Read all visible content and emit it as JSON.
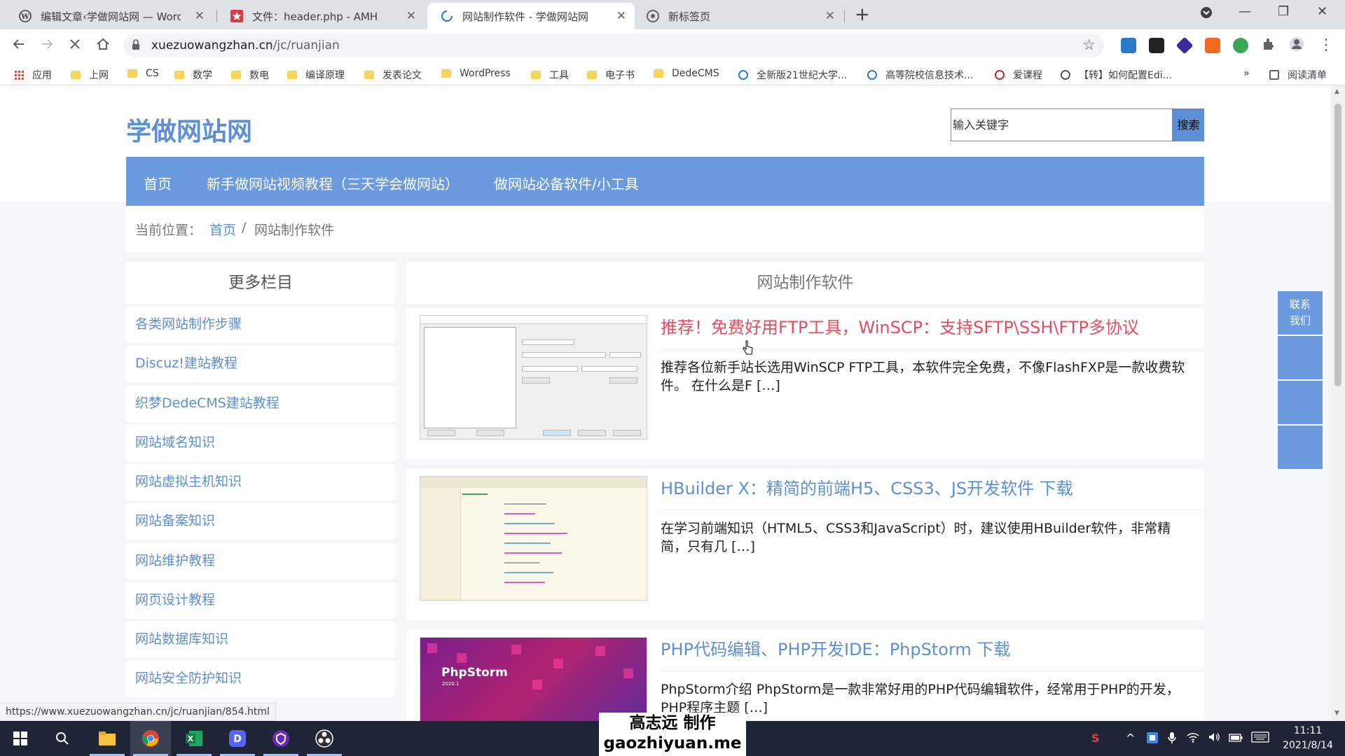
{
  "browser": {
    "tabs": [
      {
        "title": "编辑文章‹学做网站网 — Word",
        "close": "✕"
      },
      {
        "title": "文件：header.php - AMH",
        "close": "✕"
      },
      {
        "title": "网站制作软件 - 学做网站网",
        "close": "✕"
      },
      {
        "title": "新标签页",
        "close": "✕"
      }
    ],
    "new_tab": "+",
    "window_controls": {
      "minimize": "—",
      "restore": "❐",
      "close": "✕"
    },
    "url_host": "xuezuowangzhan.cn",
    "url_path": "/jc/ruanjian",
    "bookmarks": [
      "应用",
      "上网",
      "CS",
      "数学",
      "数电",
      "编译原理",
      "发表论文",
      "WordPress",
      "工具",
      "电子书",
      "DedeCMS",
      "全新版21世纪大学...",
      "高等院校信息技术...",
      "爱课程",
      "【转】如何配置Edi...",
      "»",
      "阅读清单"
    ]
  },
  "site": {
    "logo": "学做网站网",
    "search_placeholder": "输入关键字",
    "search_button": "搜索",
    "nav": [
      "首页",
      "新手做网站视频教程（三天学会做网站）",
      "做网站必备软件/小工具"
    ],
    "breadcrumb": {
      "prefix": "当前位置：",
      "home": "首页",
      "sep": " / ",
      "current": "网站制作软件"
    }
  },
  "sidebar": {
    "title": "更多栏目",
    "items": [
      "各类网站制作步骤",
      "Discuz!建站教程",
      "织梦DedeCMS建站教程",
      "网站域名知识",
      "网站虚拟主机知识",
      "网站备案知识",
      "网站维护教程",
      "网页设计教程",
      "网站数据库知识",
      "网站安全防护知识"
    ]
  },
  "main": {
    "title": "网站制作软件",
    "posts": [
      {
        "title": "推荐！免费好用FTP工具，WinSCP：支持SFTP\\SSH\\FTP多协议",
        "excerpt": "推荐各位新手站长选用WinSCP FTP工具，本软件完全免费，不像FlashFXP是一款收费软件。 在什么是F […]",
        "highlight": true
      },
      {
        "title": "HBuilder X：精简的前端H5、CSS3、JS开发软件 下载",
        "excerpt": "在学习前端知识（HTML5、CSS3和JavaScript）时，建议使用HBuilder软件，非常精简，只有几 […]",
        "highlight": false
      },
      {
        "title": "PHP代码编辑、PHP开发IDE：PhpStorm 下载",
        "excerpt": "PhpStorm介绍 PhpStorm是一款非常好用的PHP代码编辑软件，经常用于PHP的开发，PHP程序主题 […]",
        "highlight": false
      }
    ],
    "thumb3_brand": "PhpStorm",
    "thumb3_version": "2020.1"
  },
  "contact": "联系我们",
  "status_url": "https://www.xuezuowangzhan.cn/jc/ruanjian/854.html",
  "watermark": {
    "line1": "高志远 制作",
    "line2": "gaozhiyuan.me"
  },
  "taskbar": {
    "time": "11:11",
    "date": "2021/8/14"
  },
  "colors": {
    "accent": "#5d8fd6",
    "nav": "#6c9ade",
    "highlight_title": "#e74c5e"
  }
}
